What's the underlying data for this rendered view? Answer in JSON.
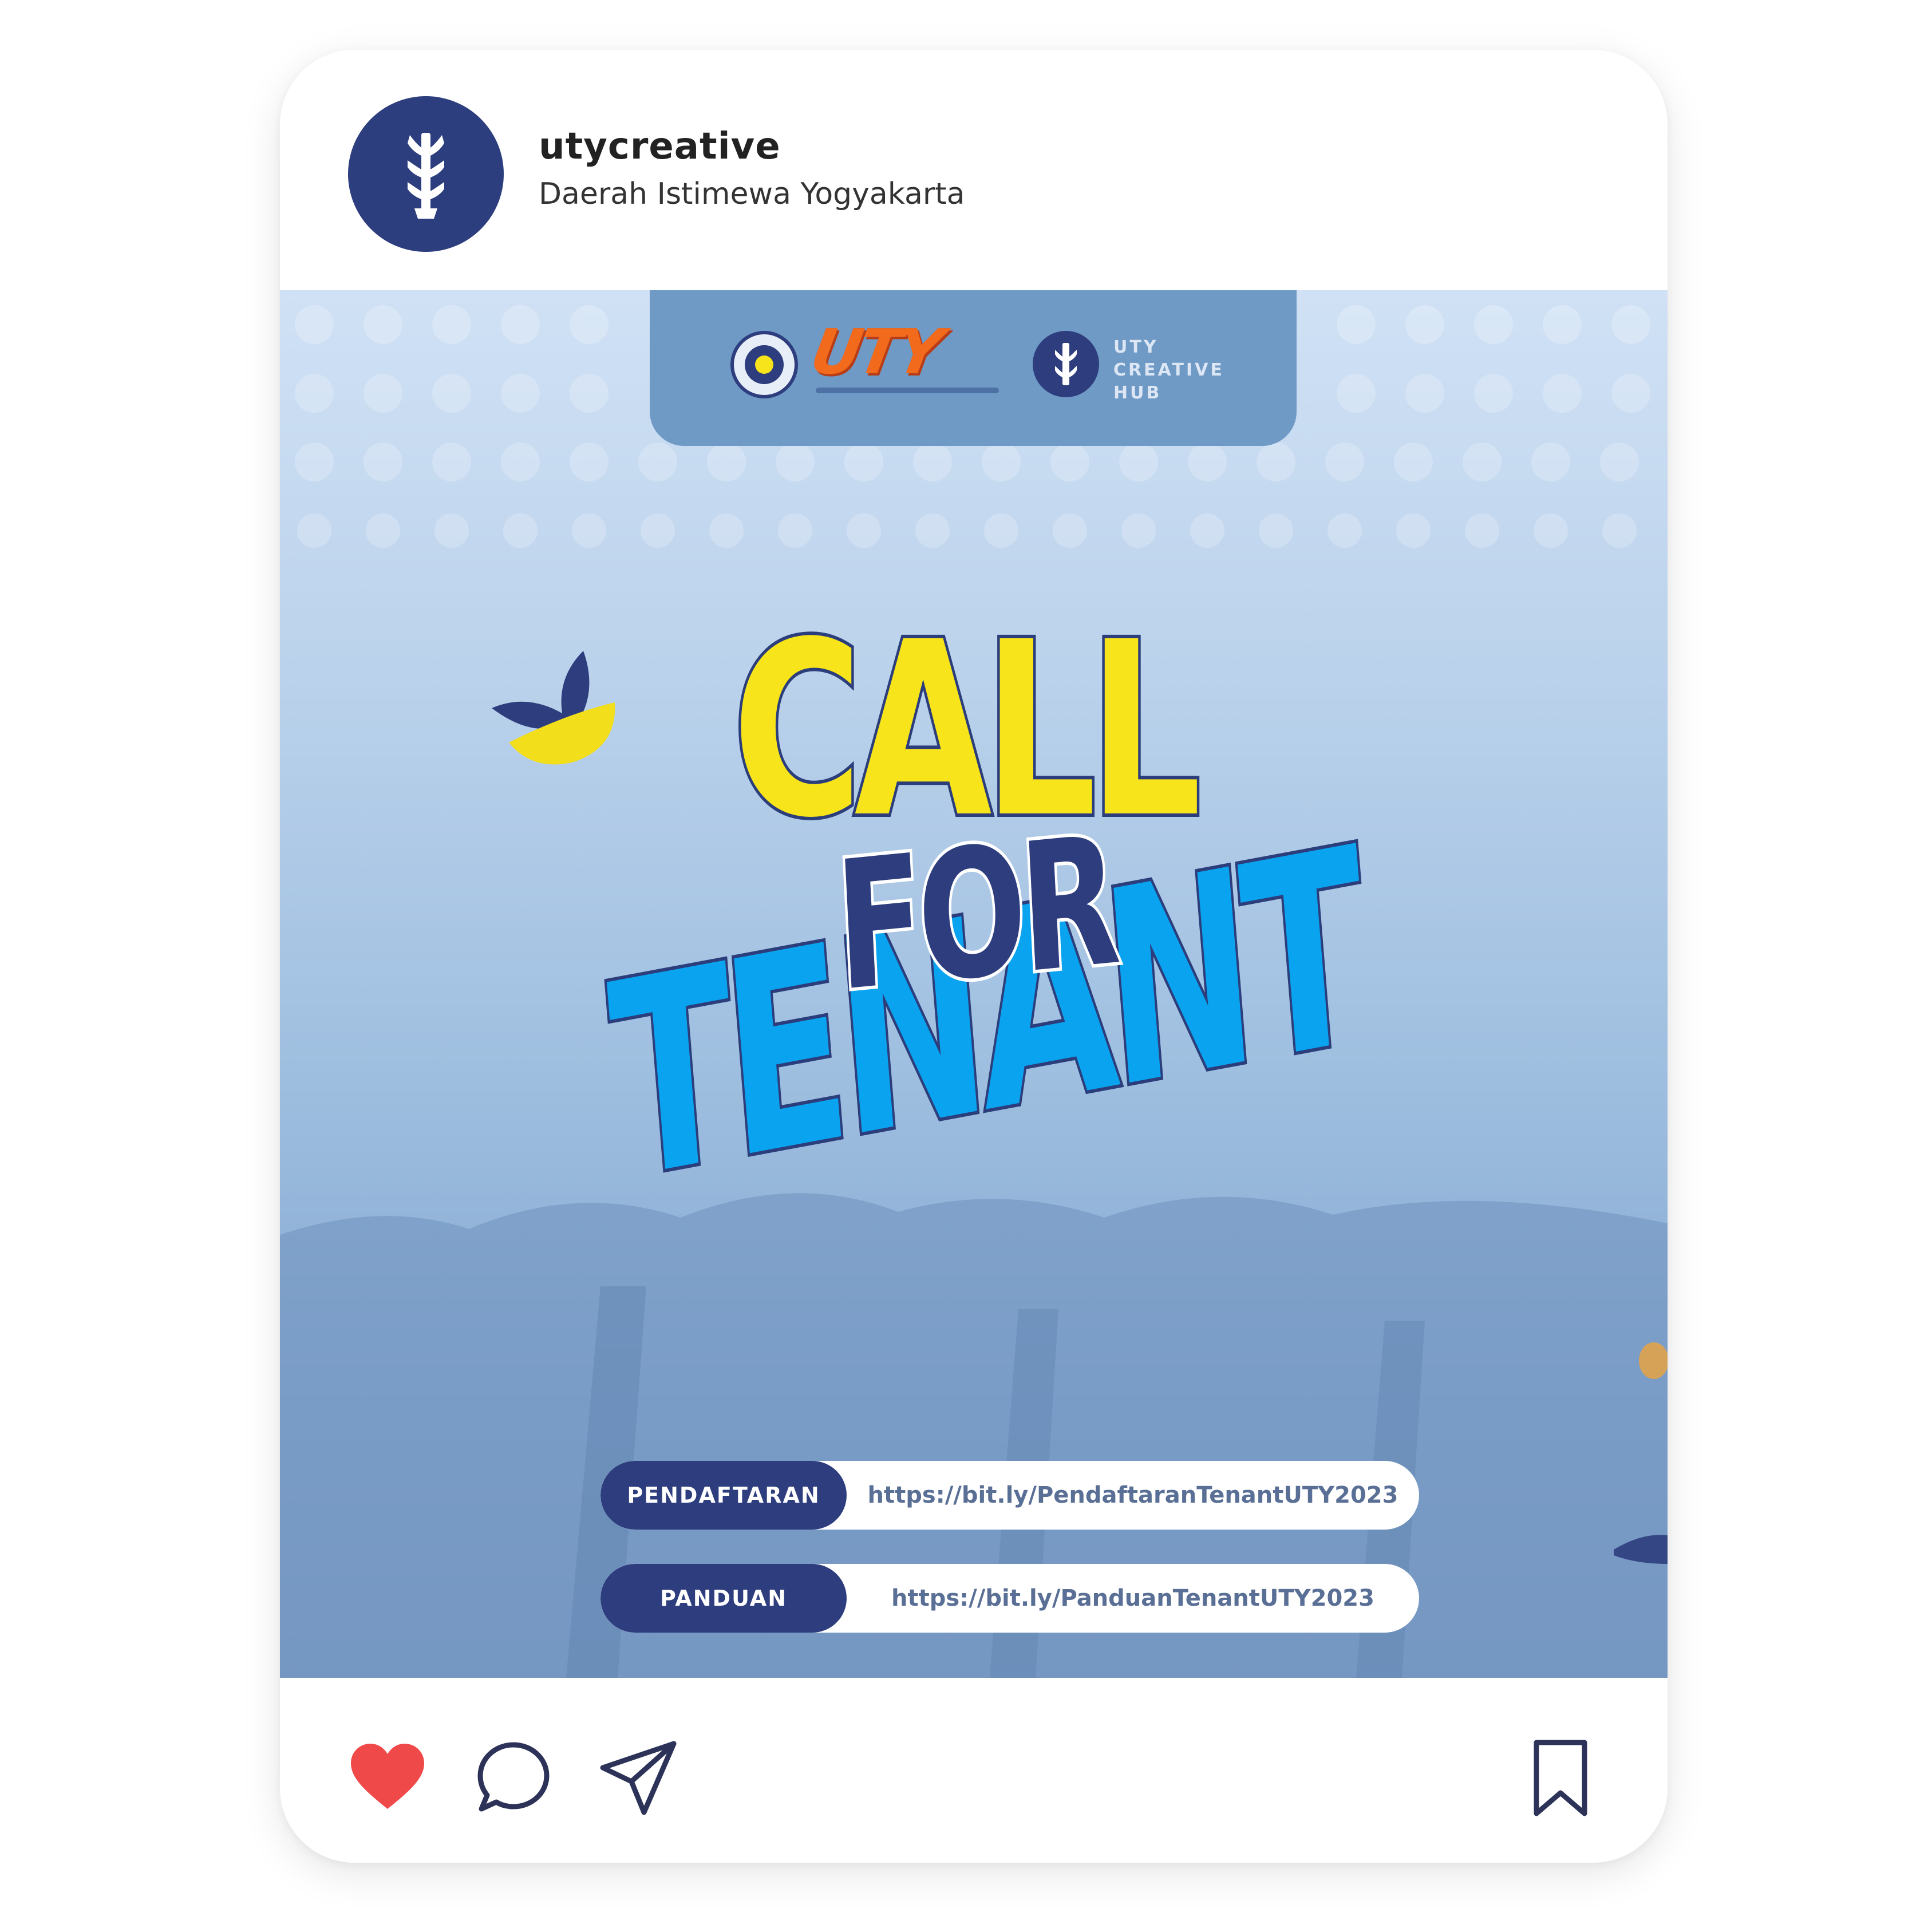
{
  "account": {
    "username": "utycreative",
    "location": "Daerah Istimewa Yogyakarta",
    "avatar_icon": "uty-creative-hub-logo-icon"
  },
  "post": {
    "logos": {
      "university_logo": "UTY",
      "hub_logo_lines": [
        "UTY",
        "CREATIVE",
        "HUB"
      ]
    },
    "headline": {
      "line1": "CALL",
      "line2": "FOR",
      "line3": "TENANT"
    },
    "links": [
      {
        "label": "PENDAFTARAN",
        "url": "https://bit.ly/PendaftaranTenantUTY2023"
      },
      {
        "label": "PANDUAN",
        "url": "https://bit.ly/PanduanTenantUTY2023"
      }
    ],
    "colors": {
      "navy": "#2d3d7d",
      "yellow": "#f7e41a",
      "sky_blue": "#0aa3f0",
      "orange": "#f26b1d"
    }
  },
  "actions": {
    "like_icon": "heart-icon",
    "comment_icon": "comment-icon",
    "share_icon": "send-icon",
    "save_icon": "bookmark-icon",
    "liked": true,
    "like_color": "#f0494a"
  }
}
